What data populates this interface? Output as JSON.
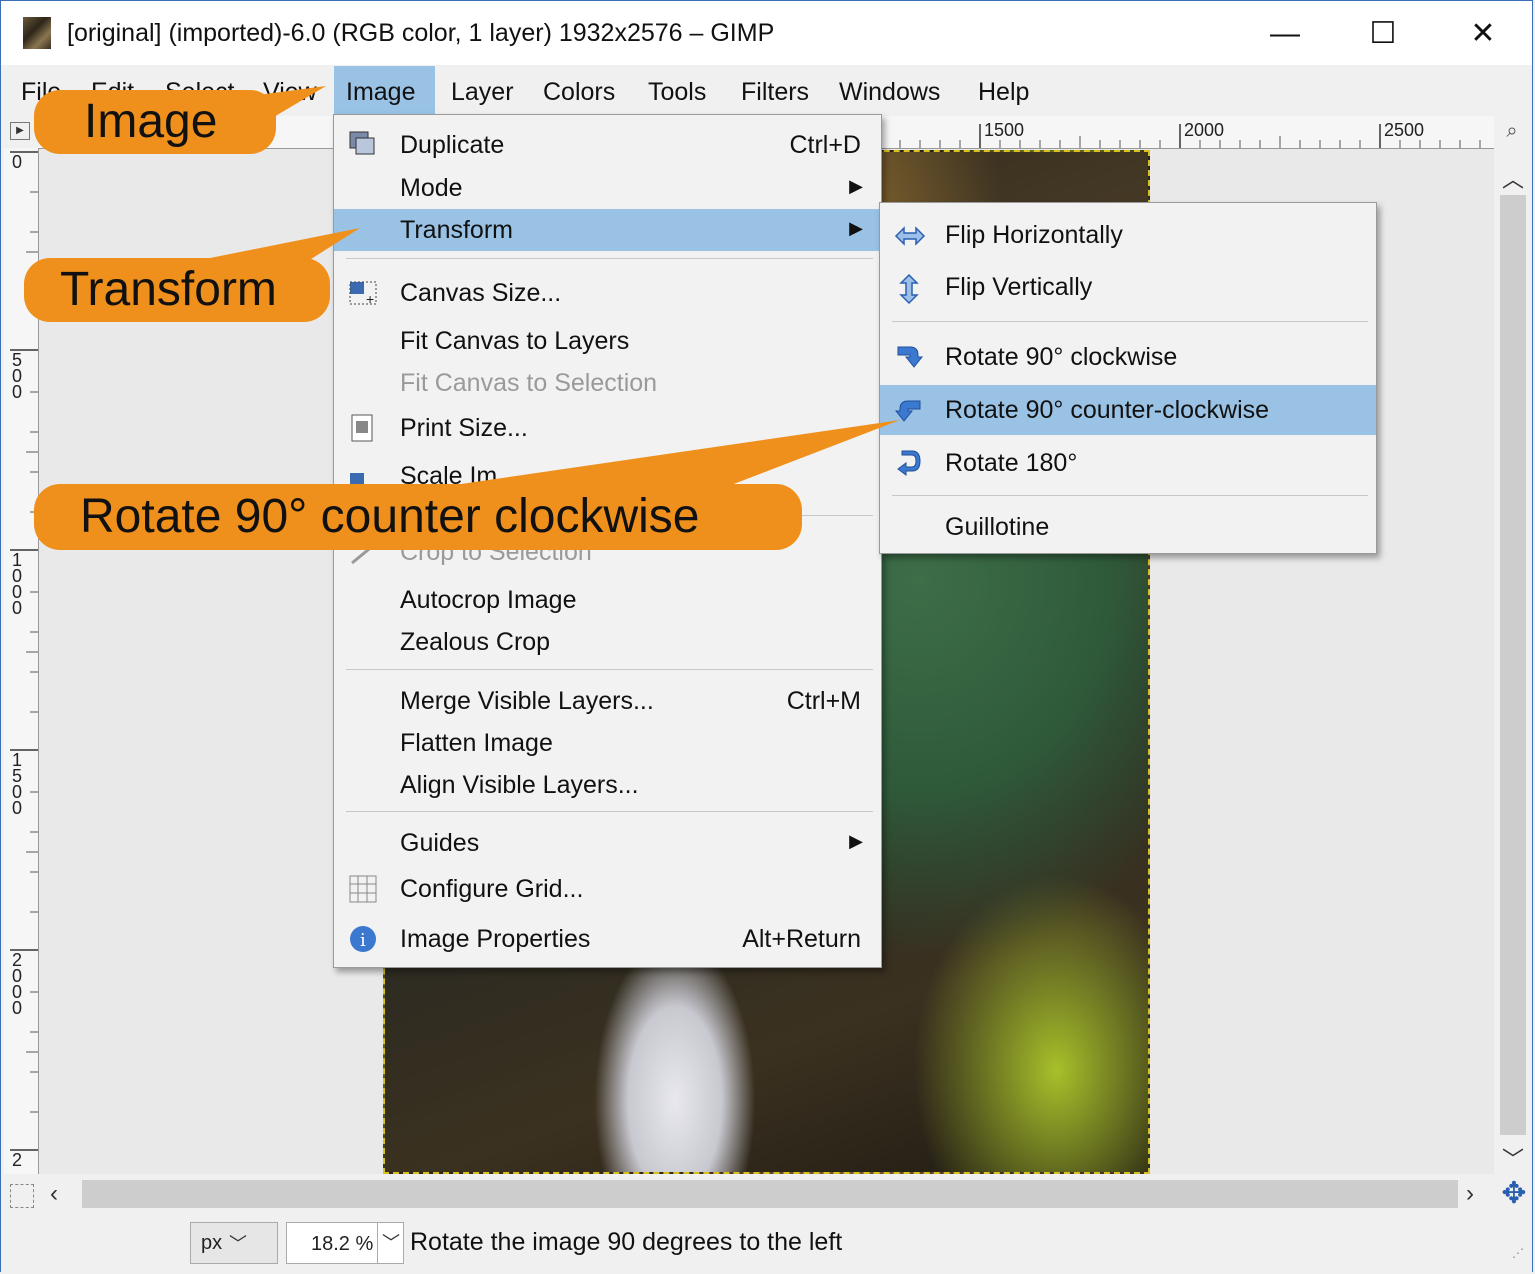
{
  "window": {
    "title": "[original] (imported)-6.0 (RGB color, 1 layer) 1932x2576 – GIMP",
    "minimize": "—",
    "maximize": "☐",
    "close": "✕"
  },
  "menubar": {
    "items": [
      "File",
      "Edit",
      "Select",
      "View",
      "Image",
      "Layer",
      "Colors",
      "Tools",
      "Filters",
      "Windows",
      "Help"
    ],
    "active": "Image"
  },
  "ruler": {
    "top_labels": [
      "1500",
      "2000",
      "2500"
    ],
    "left_labels": [
      "0",
      "500",
      "1000",
      "1500",
      "2000",
      "2"
    ]
  },
  "image_menu": {
    "duplicate": {
      "label": "Duplicate",
      "shortcut": "Ctrl+D"
    },
    "mode": {
      "label": "Mode"
    },
    "transform": {
      "label": "Transform"
    },
    "canvas_size": {
      "label": "Canvas Size..."
    },
    "fit_canvas_layers": {
      "label": "Fit Canvas to Layers"
    },
    "fit_canvas_selection": {
      "label": "Fit Canvas to Selection"
    },
    "print_size": {
      "label": "Print Size..."
    },
    "scale_image": {
      "label": "Scale Im..."
    },
    "crop_to_selection": {
      "label": "Crop to Selection"
    },
    "autocrop": {
      "label": "Autocrop Image"
    },
    "zealous_crop": {
      "label": "Zealous Crop"
    },
    "merge_visible": {
      "label": "Merge Visible Layers...",
      "shortcut": "Ctrl+M"
    },
    "flatten": {
      "label": "Flatten Image"
    },
    "align_visible": {
      "label": "Align Visible Layers..."
    },
    "guides": {
      "label": "Guides"
    },
    "configure_grid": {
      "label": "Configure Grid..."
    },
    "image_properties": {
      "label": "Image Properties",
      "shortcut": "Alt+Return"
    }
  },
  "transform_menu": {
    "flip_h": "Flip Horizontally",
    "flip_v": "Flip Vertically",
    "rot_cw": "Rotate 90° clockwise",
    "rot_ccw": "Rotate 90° counter-clockwise",
    "rot_180": "Rotate 180°",
    "guillotine": "Guillotine"
  },
  "callouts": {
    "image": "Image",
    "transform": "Transform",
    "rotate": "Rotate 90° counter clockwise"
  },
  "statusbar": {
    "unit": "px",
    "zoom": "18.2 %",
    "message": "Rotate the image 90 degrees to the left"
  },
  "colors": {
    "callout": "#f0901c",
    "highlight": "#99c2e4",
    "selection_border": "#d8c020"
  }
}
